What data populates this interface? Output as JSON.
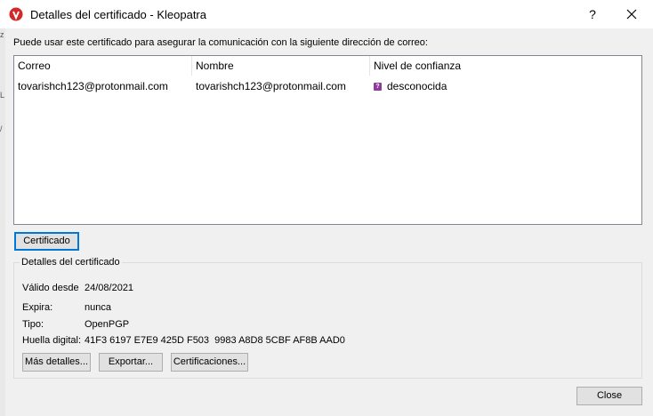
{
  "window": {
    "title": "Detalles del certificado - Kleopatra",
    "help_label": "?",
    "edge_chars": [
      "z",
      "L",
      "/"
    ]
  },
  "intro_text": "Puede usar este certificado para asegurar la comunicación con la siguiente dirección de correo:",
  "table": {
    "columns": [
      "Correo",
      "Nombre",
      "Nivel de confianza"
    ],
    "rows": [
      {
        "correo": "tovarishch123@protonmail.com",
        "nombre": "tovarishch123@protonmail.com",
        "confianza": "desconocida",
        "trust_icon": "?"
      }
    ]
  },
  "buttons": {
    "certificado": "Certificado",
    "mas_detalles": "Más detalles...",
    "exportar": "Exportar...",
    "certificaciones": "Certificaciones...",
    "close": "Close"
  },
  "details": {
    "group_title": "Detalles del certificado",
    "valid_from_label": "Válido desde",
    "valid_from_value": "24/08/2021",
    "expires_label": "Expira:",
    "expires_value": "nunca",
    "type_label": "Tipo:",
    "type_value": "OpenPGP",
    "fingerprint_label": "Huella digital:",
    "fingerprint_value": "41F3 6197 E7E9 425D F503  9983 A8D8 5CBF AF8B AAD0"
  },
  "colors": {
    "accent": "#0078d7",
    "trust_unknown": "#8e3c9a",
    "app_icon": "#d42727"
  }
}
